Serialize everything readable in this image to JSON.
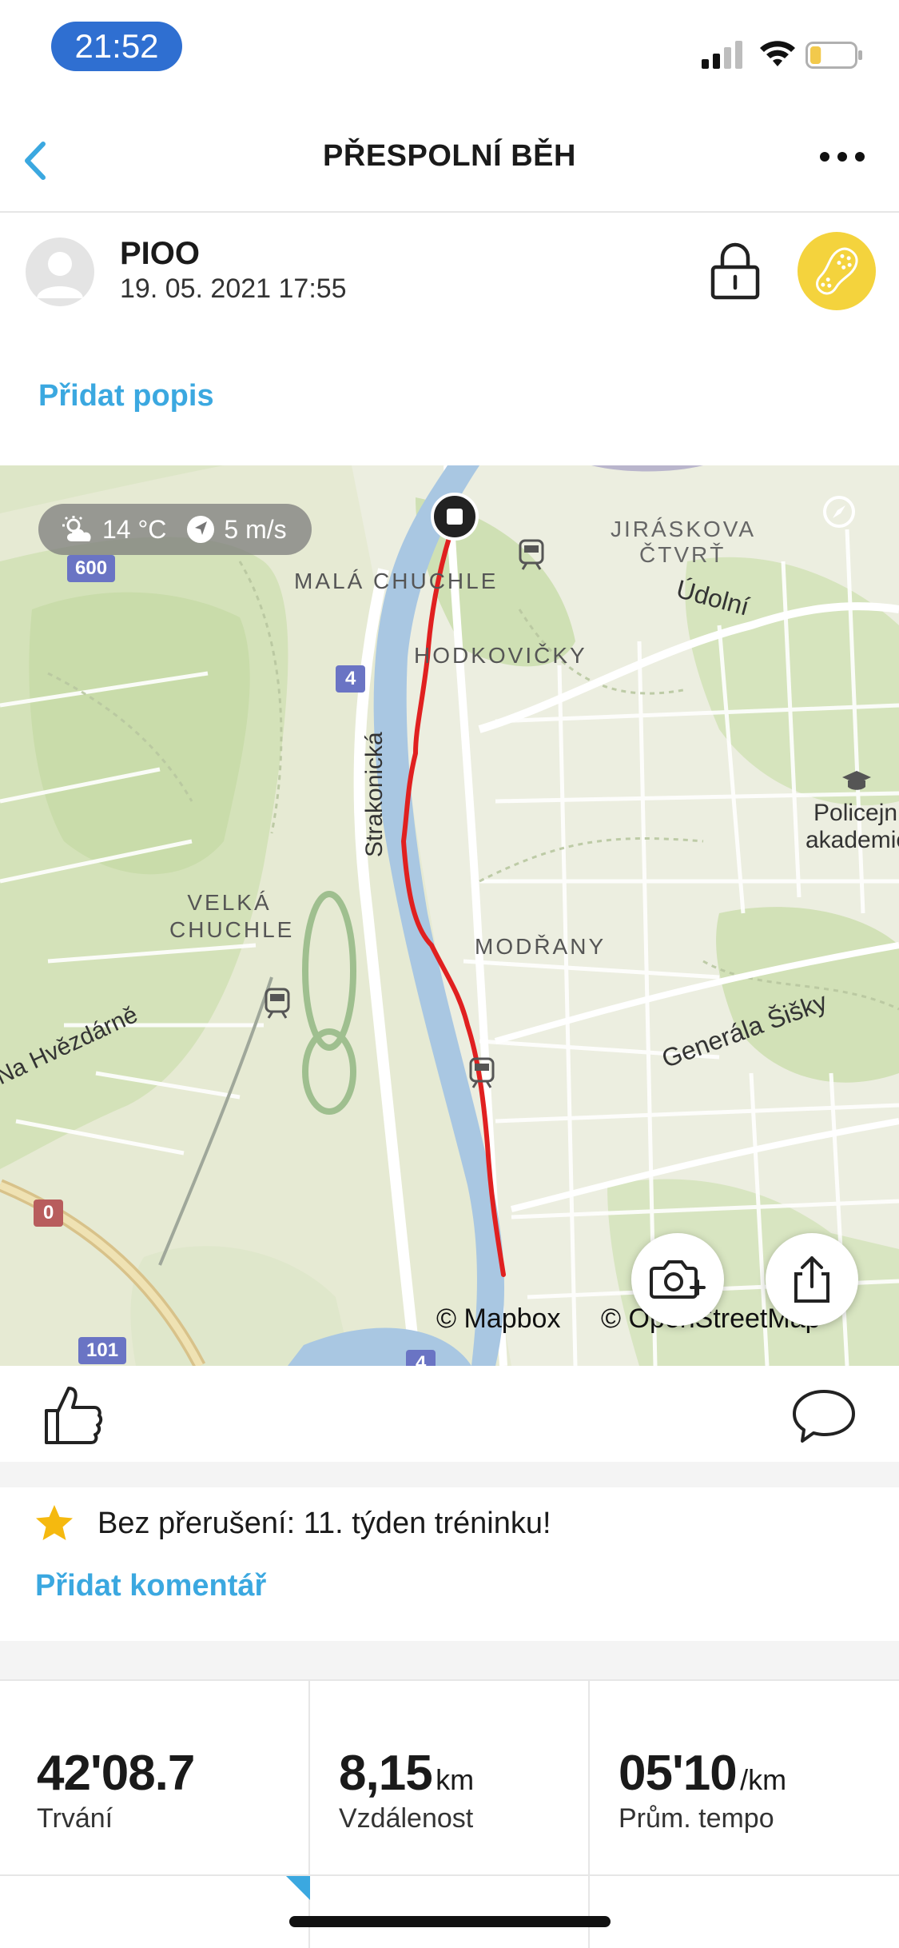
{
  "status_bar": {
    "time": "21:52",
    "battery_level": 0.25
  },
  "nav": {
    "title": "PŘESPOLNÍ BĚH"
  },
  "activity": {
    "user": "PIOO",
    "datetime": "19. 05. 2021 17:55"
  },
  "description": {
    "add_label": "Přidat popis"
  },
  "map": {
    "weather": {
      "temperature": "14 °C",
      "wind": "5 m/s"
    },
    "labels": {
      "mala_chuchle": "MALÁ CHUCHLE",
      "hodkovicky": "HODKOVIČKY",
      "jiraskova": "JIRÁSKOVA",
      "ctvrt": "ČTVRŤ",
      "udolni": "Údolní",
      "strakonicka": "Strakonická",
      "velka_chuchle": "VELKÁ CHUCHLE",
      "modrany": "MODŘANY",
      "na_hvezdarne": "Na Hvězdárně",
      "generala_sisky": "Generála Šišky",
      "policejni": "Policejní",
      "akademie": "akademie"
    },
    "road_shields": {
      "r600": "600",
      "r4": "4",
      "r0": "0",
      "r101": "101",
      "r4b": "4"
    },
    "attribution": {
      "mapbox": "© Mapbox",
      "osm": "© OpenStreetMap"
    },
    "route_color": "#e02020"
  },
  "achievement": {
    "text": "Bez přerušení: 11. týden tréninku!"
  },
  "comments": {
    "add_label": "Přidat komentář"
  },
  "stats": [
    {
      "value": "42'08.7",
      "unit": "",
      "label": "Trvání"
    },
    {
      "value": "8,15",
      "unit": "km",
      "label": "Vzdálenost"
    },
    {
      "value": "05'10",
      "unit": "/km",
      "label": "Prům. tempo"
    }
  ],
  "colors": {
    "accent": "#3ba8e0",
    "status_pill": "#2f6fd1",
    "sport_badge": "#f4d33d"
  }
}
